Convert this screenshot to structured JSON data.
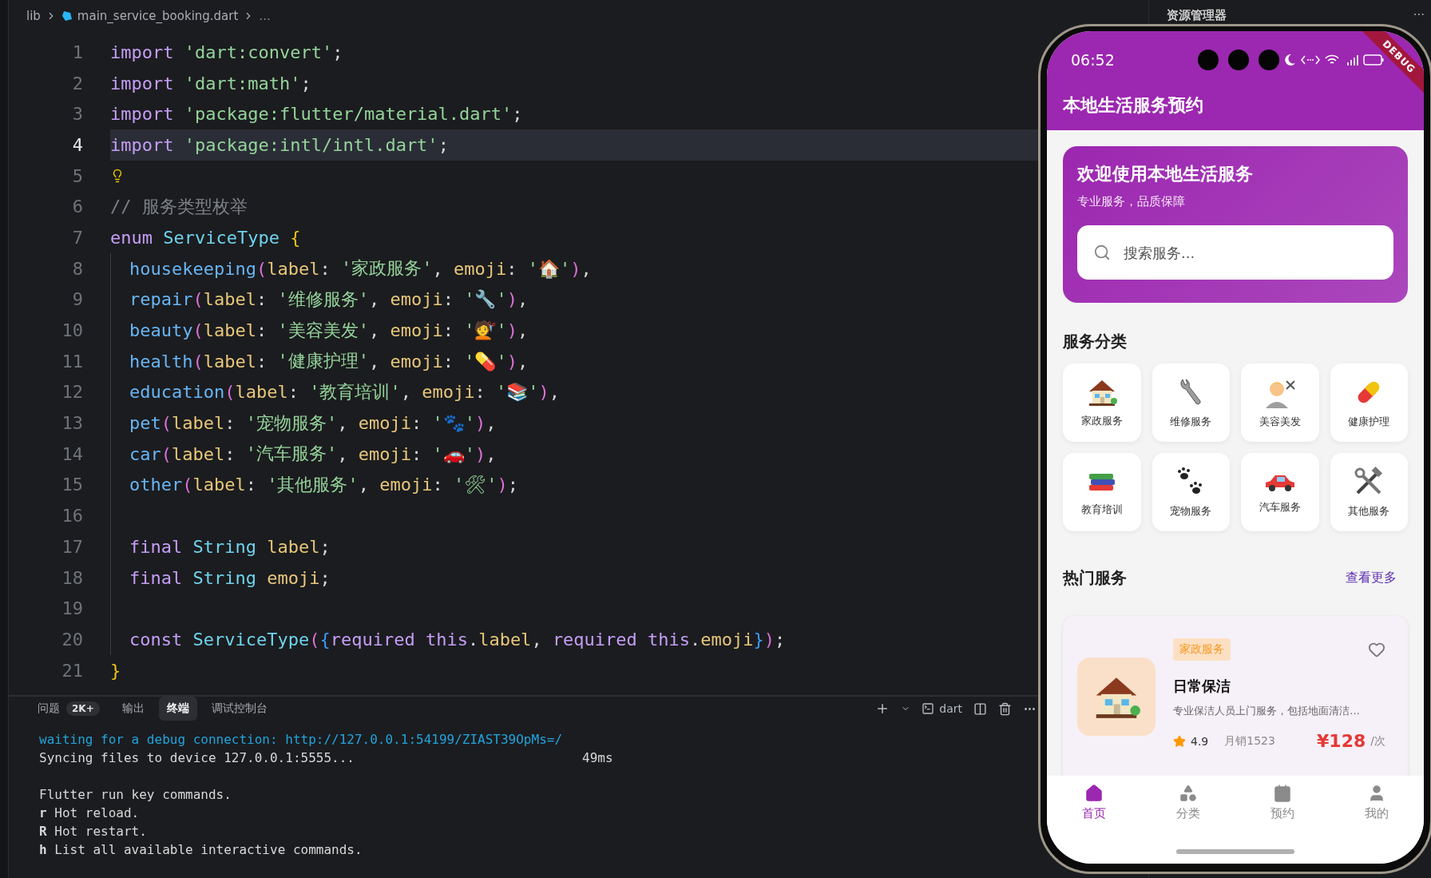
{
  "editor": {
    "breadcrumb": [
      {
        "text": "lib",
        "kind": "folder"
      },
      {
        "text": "main_service_booking.dart",
        "kind": "file"
      },
      {
        "text": "...",
        "kind": "more"
      }
    ],
    "code": {
      "lines": [
        {
          "number": "1",
          "current": false,
          "hint": false,
          "tokens": [
            {
              "text": "import",
              "kind": "kw"
            },
            {
              "text": " 'dart:convert'",
              "kind": "str"
            },
            {
              "text": ";",
              "kind": "punct"
            }
          ]
        },
        {
          "number": "2",
          "current": false,
          "hint": false,
          "tokens": [
            {
              "text": "import",
              "kind": "kw"
            },
            {
              "text": " 'dart:math'",
              "kind": "str"
            },
            {
              "text": ";",
              "kind": "punct"
            }
          ]
        },
        {
          "number": "3",
          "current": false,
          "hint": false,
          "tokens": [
            {
              "text": "import",
              "kind": "kw"
            },
            {
              "text": " 'package:flutter/material.dart'",
              "kind": "str"
            },
            {
              "text": ";",
              "kind": "punct"
            }
          ]
        },
        {
          "number": "4",
          "current": true,
          "hint": false,
          "tokens": [
            {
              "text": "import",
              "kind": "kw"
            },
            {
              "text": " 'package:intl/intl.dart'",
              "kind": "str"
            },
            {
              "text": ";",
              "kind": "punct"
            }
          ]
        },
        {
          "number": "5",
          "current": false,
          "hint": true
        },
        {
          "number": "6",
          "current": false,
          "hint": false,
          "tokens": [
            {
              "text": "// 服务类型枚举",
              "kind": "comment"
            }
          ]
        },
        {
          "number": "7",
          "current": false,
          "hint": false,
          "tokens": [
            {
              "text": "enum",
              "kind": "kw"
            },
            {
              "text": " ServiceType",
              "kind": "type"
            },
            {
              "text": " {",
              "kind": "brace1"
            }
          ],
          "children": [
            {
              "number": "8",
              "current": false,
              "hint": false,
              "tokens": [
                {
                  "text": "housekeeping",
                  "kind": "member"
                },
                {
                  "text": "(",
                  "kind": "brace2"
                },
                {
                  "text": "label",
                  "kind": "param"
                },
                {
                  "text": ": ",
                  "kind": "punct"
                },
                {
                  "text": "'家政服务'",
                  "kind": "str"
                },
                {
                  "text": ", ",
                  "kind": "punct"
                },
                {
                  "text": "emoji",
                  "kind": "param"
                },
                {
                  "text": ": ",
                  "kind": "punct"
                },
                {
                  "text": "'🏠'",
                  "kind": "str"
                },
                {
                  "text": ")",
                  "kind": "brace2"
                },
                {
                  "text": ",",
                  "kind": "punct"
                }
              ]
            },
            {
              "number": "9",
              "current": false,
              "hint": false,
              "tokens": [
                {
                  "text": "repair",
                  "kind": "member"
                },
                {
                  "text": "(",
                  "kind": "brace2"
                },
                {
                  "text": "label",
                  "kind": "param"
                },
                {
                  "text": ": ",
                  "kind": "punct"
                },
                {
                  "text": "'维修服务'",
                  "kind": "str"
                },
                {
                  "text": ", ",
                  "kind": "punct"
                },
                {
                  "text": "emoji",
                  "kind": "param"
                },
                {
                  "text": ": ",
                  "kind": "punct"
                },
                {
                  "text": "'🔧'",
                  "kind": "str"
                },
                {
                  "text": ")",
                  "kind": "brace2"
                },
                {
                  "text": ",",
                  "kind": "punct"
                }
              ]
            },
            {
              "number": "10",
              "current": false,
              "hint": false,
              "tokens": [
                {
                  "text": "beauty",
                  "kind": "member"
                },
                {
                  "text": "(",
                  "kind": "brace2"
                },
                {
                  "text": "label",
                  "kind": "param"
                },
                {
                  "text": ": ",
                  "kind": "punct"
                },
                {
                  "text": "'美容美发'",
                  "kind": "str"
                },
                {
                  "text": ", ",
                  "kind": "punct"
                },
                {
                  "text": "emoji",
                  "kind": "param"
                },
                {
                  "text": ": ",
                  "kind": "punct"
                },
                {
                  "text": "'💇'",
                  "kind": "str"
                },
                {
                  "text": ")",
                  "kind": "brace2"
                },
                {
                  "text": ",",
                  "kind": "punct"
                }
              ]
            },
            {
              "number": "11",
              "current": false,
              "hint": false,
              "tokens": [
                {
                  "text": "health",
                  "kind": "member"
                },
                {
                  "text": "(",
                  "kind": "brace2"
                },
                {
                  "text": "label",
                  "kind": "param"
                },
                {
                  "text": ": ",
                  "kind": "punct"
                },
                {
                  "text": "'健康护理'",
                  "kind": "str"
                },
                {
                  "text": ", ",
                  "kind": "punct"
                },
                {
                  "text": "emoji",
                  "kind": "param"
                },
                {
                  "text": ": ",
                  "kind": "punct"
                },
                {
                  "text": "'💊'",
                  "kind": "str"
                },
                {
                  "text": ")",
                  "kind": "brace2"
                },
                {
                  "text": ",",
                  "kind": "punct"
                }
              ]
            },
            {
              "number": "12",
              "current": false,
              "hint": false,
              "tokens": [
                {
                  "text": "education",
                  "kind": "member"
                },
                {
                  "text": "(",
                  "kind": "brace2"
                },
                {
                  "text": "label",
                  "kind": "param"
                },
                {
                  "text": ": ",
                  "kind": "punct"
                },
                {
                  "text": "'教育培训'",
                  "kind": "str"
                },
                {
                  "text": ", ",
                  "kind": "punct"
                },
                {
                  "text": "emoji",
                  "kind": "param"
                },
                {
                  "text": ": ",
                  "kind": "punct"
                },
                {
                  "text": "'📚'",
                  "kind": "str"
                },
                {
                  "text": ")",
                  "kind": "brace2"
                },
                {
                  "text": ",",
                  "kind": "punct"
                }
              ]
            },
            {
              "number": "13",
              "current": false,
              "hint": false,
              "tokens": [
                {
                  "text": "pet",
                  "kind": "member"
                },
                {
                  "text": "(",
                  "kind": "brace2"
                },
                {
                  "text": "label",
                  "kind": "param"
                },
                {
                  "text": ": ",
                  "kind": "punct"
                },
                {
                  "text": "'宠物服务'",
                  "kind": "str"
                },
                {
                  "text": ", ",
                  "kind": "punct"
                },
                {
                  "text": "emoji",
                  "kind": "param"
                },
                {
                  "text": ": ",
                  "kind": "punct"
                },
                {
                  "text": "'🐾'",
                  "kind": "str"
                },
                {
                  "text": ")",
                  "kind": "brace2"
                },
                {
                  "text": ",",
                  "kind": "punct"
                }
              ]
            },
            {
              "number": "14",
              "current": false,
              "hint": false,
              "tokens": [
                {
                  "text": "car",
                  "kind": "member"
                },
                {
                  "text": "(",
                  "kind": "brace2"
                },
                {
                  "text": "label",
                  "kind": "param"
                },
                {
                  "text": ": ",
                  "kind": "punct"
                },
                {
                  "text": "'汽车服务'",
                  "kind": "str"
                },
                {
                  "text": ", ",
                  "kind": "punct"
                },
                {
                  "text": "emoji",
                  "kind": "param"
                },
                {
                  "text": ": ",
                  "kind": "punct"
                },
                {
                  "text": "'🚗'",
                  "kind": "str"
                },
                {
                  "text": ")",
                  "kind": "brace2"
                },
                {
                  "text": ",",
                  "kind": "punct"
                }
              ]
            },
            {
              "number": "15",
              "current": false,
              "hint": false,
              "tokens": [
                {
                  "text": "other",
                  "kind": "member"
                },
                {
                  "text": "(",
                  "kind": "brace2"
                },
                {
                  "text": "label",
                  "kind": "param"
                },
                {
                  "text": ": ",
                  "kind": "punct"
                },
                {
                  "text": "'其他服务'",
                  "kind": "str"
                },
                {
                  "text": ", ",
                  "kind": "punct"
                },
                {
                  "text": "emoji",
                  "kind": "param"
                },
                {
                  "text": ": ",
                  "kind": "punct"
                },
                {
                  "text": "'🛠'",
                  "kind": "str"
                },
                {
                  "text": ")",
                  "kind": "brace2"
                },
                {
                  "text": ";",
                  "kind": "punct"
                }
              ]
            },
            {
              "number": "16",
              "current": false,
              "hint": false
            },
            {
              "number": "17",
              "current": false,
              "hint": false,
              "tokens": [
                {
                  "text": "final",
                  "kind": "kw"
                },
                {
                  "text": " String",
                  "kind": "type"
                },
                {
                  "text": " label",
                  "kind": "param"
                },
                {
                  "text": ";",
                  "kind": "punct"
                }
              ]
            },
            {
              "number": "18",
              "current": false,
              "hint": false,
              "tokens": [
                {
                  "text": "final",
                  "kind": "kw"
                },
                {
                  "text": " String",
                  "kind": "type"
                },
                {
                  "text": " emoji",
                  "kind": "param"
                },
                {
                  "text": ";",
                  "kind": "punct"
                }
              ]
            },
            {
              "number": "19",
              "current": false,
              "hint": false
            },
            {
              "number": "20",
              "current": false,
              "hint": false,
              "tokens": [
                {
                  "text": "const",
                  "kind": "kw"
                },
                {
                  "text": " ServiceType",
                  "kind": "type"
                },
                {
                  "text": "(",
                  "kind": "brace2"
                },
                {
                  "text": "{",
                  "kind": "brace3"
                },
                {
                  "text": "required",
                  "kind": "kw"
                },
                {
                  "text": " this",
                  "kind": "kw"
                },
                {
                  "text": ".",
                  "kind": "punct"
                },
                {
                  "text": "label",
                  "kind": "param"
                },
                {
                  "text": ", ",
                  "kind": "punct"
                },
                {
                  "text": "required",
                  "kind": "kw"
                },
                {
                  "text": " this",
                  "kind": "kw"
                },
                {
                  "text": ".",
                  "kind": "punct"
                },
                {
                  "text": "emoji",
                  "kind": "param"
                },
                {
                  "text": "}",
                  "kind": "brace3"
                },
                {
                  "text": ")",
                  "kind": "brace2"
                },
                {
                  "text": ";",
                  "kind": "punct"
                }
              ]
            }
          ]
        },
        {
          "number": "21",
          "current": false,
          "hint": false,
          "tokens": [
            {
              "text": "}",
              "kind": "brace1"
            }
          ]
        }
      ]
    }
  },
  "panel": {
    "tabs": [
      {
        "label": "问题",
        "badge": "2K+",
        "selected": false
      },
      {
        "label": "输出",
        "selected": false
      },
      {
        "label": "终端",
        "selected": true
      },
      {
        "label": "调试控制台",
        "selected": false
      }
    ],
    "shell": "dart",
    "terminal": [
      [
        {
          "text": "waiting for a debug connection: http://127.0.0.1:54199/ZIAST39OpMs=/",
          "kind": "info"
        },
        {
          "text": "Syncing files to device 127.0.0.1:5555...",
          "kind": "plain",
          "timing": "49ms"
        }
      ],
      [
        {
          "text": "Flutter run key commands.",
          "kind": "plain"
        },
        {
          "text": "**r** Hot reload.",
          "kind": "plain"
        },
        {
          "text": "**R** Hot restart.",
          "kind": "plain"
        },
        {
          "text": "**h** List all available interactive commands.",
          "kind": "plain"
        }
      ]
    ]
  },
  "explorer": {
    "title": "资源管理器",
    "more": "···"
  },
  "phone": {
    "status": {
      "time": "06:52",
      "debug_banner": "DEBUG"
    },
    "app_title": "本地生活服务预约",
    "welcome": {
      "title": "欢迎使用本地生活服务",
      "subtitle": "专业服务，品质保障",
      "search_placeholder": "搜索服务..."
    },
    "categories": {
      "title": "服务分类",
      "items": [
        {
          "label": "家政服务"
        },
        {
          "label": "维修服务"
        },
        {
          "label": "美容美发"
        },
        {
          "label": "健康护理"
        },
        {
          "label": "教育培训"
        },
        {
          "label": "宠物服务"
        },
        {
          "label": "汽车服务"
        },
        {
          "label": "其他服务"
        }
      ]
    },
    "hot": {
      "title": "热门服务",
      "more_link": "查看更多",
      "items": [
        {
          "tag": "家政服务",
          "title": "日常保洁",
          "description": "专业保洁人员上门服务，包括地面清洁…",
          "rating": "4.9",
          "sales": "月销1523",
          "price": "¥128",
          "unit": "/次",
          "favorite": false
        }
      ]
    },
    "nav": [
      {
        "label": "首页",
        "selected": true
      },
      {
        "label": "分类",
        "selected": false
      },
      {
        "label": "预约",
        "selected": false
      },
      {
        "label": "我的",
        "selected": false
      }
    ]
  }
}
